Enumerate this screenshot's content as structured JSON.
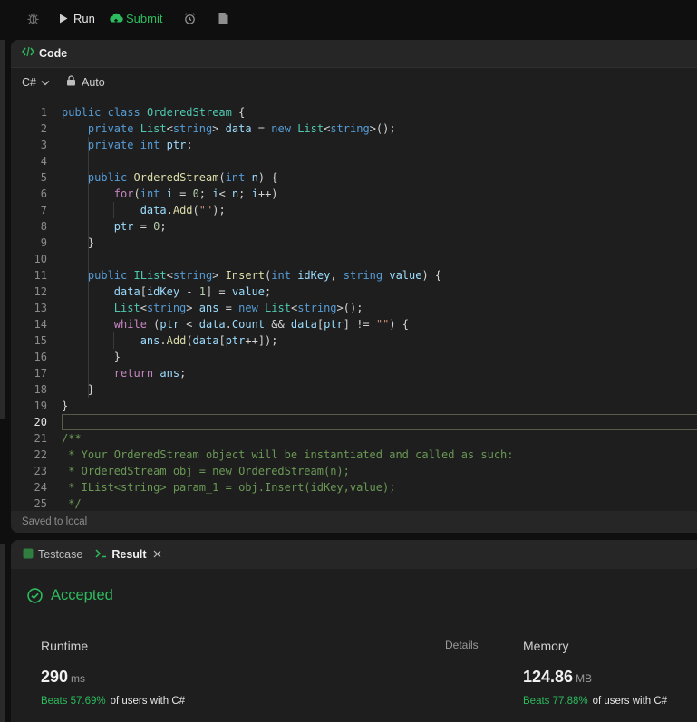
{
  "toolbar": {
    "run_label": "Run",
    "submit_label": "Submit"
  },
  "code_panel": {
    "title": "Code",
    "language": "C#",
    "mode": "Auto",
    "status": "Saved to local"
  },
  "editor": {
    "active_line": 20,
    "lines": [
      {
        "n": "1",
        "tokens": [
          [
            "kw",
            "public"
          ],
          [
            "p",
            " "
          ],
          [
            "kw",
            "class"
          ],
          [
            "p",
            " "
          ],
          [
            "ty",
            "OrderedStream"
          ],
          [
            "p",
            " {"
          ]
        ]
      },
      {
        "n": "2",
        "tokens": [
          [
            "p",
            "    "
          ],
          [
            "kw",
            "private"
          ],
          [
            "p",
            " "
          ],
          [
            "ty",
            "List"
          ],
          [
            "p",
            "<"
          ],
          [
            "kw",
            "string"
          ],
          [
            "p",
            "> "
          ],
          [
            "nm",
            "data"
          ],
          [
            "p",
            " = "
          ],
          [
            "kw",
            "new"
          ],
          [
            "p",
            " "
          ],
          [
            "ty",
            "List"
          ],
          [
            "p",
            "<"
          ],
          [
            "kw",
            "string"
          ],
          [
            "p",
            ">();"
          ]
        ]
      },
      {
        "n": "3",
        "tokens": [
          [
            "p",
            "    "
          ],
          [
            "kw",
            "private"
          ],
          [
            "p",
            " "
          ],
          [
            "kw",
            "int"
          ],
          [
            "p",
            " "
          ],
          [
            "nm",
            "ptr"
          ],
          [
            "p",
            ";"
          ]
        ]
      },
      {
        "n": "4",
        "tokens": []
      },
      {
        "n": "5",
        "tokens": [
          [
            "p",
            "    "
          ],
          [
            "kw",
            "public"
          ],
          [
            "p",
            " "
          ],
          [
            "fn",
            "OrderedStream"
          ],
          [
            "p",
            "("
          ],
          [
            "kw",
            "int"
          ],
          [
            "p",
            " "
          ],
          [
            "nm",
            "n"
          ],
          [
            "p",
            ") {"
          ]
        ]
      },
      {
        "n": "6",
        "tokens": [
          [
            "p",
            "        "
          ],
          [
            "ct",
            "for"
          ],
          [
            "p",
            "("
          ],
          [
            "kw",
            "int"
          ],
          [
            "p",
            " "
          ],
          [
            "nm",
            "i"
          ],
          [
            "p",
            " = "
          ],
          [
            "nu",
            "0"
          ],
          [
            "p",
            "; "
          ],
          [
            "nm",
            "i"
          ],
          [
            "p",
            "< "
          ],
          [
            "nm",
            "n"
          ],
          [
            "p",
            "; "
          ],
          [
            "nm",
            "i"
          ],
          [
            "p",
            "++)"
          ]
        ]
      },
      {
        "n": "7",
        "tokens": [
          [
            "p",
            "            "
          ],
          [
            "nm",
            "data"
          ],
          [
            "p",
            "."
          ],
          [
            "fn",
            "Add"
          ],
          [
            "p",
            "("
          ],
          [
            "st",
            "\"\""
          ],
          [
            "p",
            ");"
          ]
        ]
      },
      {
        "n": "8",
        "tokens": [
          [
            "p",
            "        "
          ],
          [
            "nm",
            "ptr"
          ],
          [
            "p",
            " = "
          ],
          [
            "nu",
            "0"
          ],
          [
            "p",
            ";"
          ]
        ]
      },
      {
        "n": "9",
        "tokens": [
          [
            "p",
            "    }"
          ]
        ]
      },
      {
        "n": "10",
        "tokens": []
      },
      {
        "n": "11",
        "tokens": [
          [
            "p",
            "    "
          ],
          [
            "kw",
            "public"
          ],
          [
            "p",
            " "
          ],
          [
            "ty",
            "IList"
          ],
          [
            "p",
            "<"
          ],
          [
            "kw",
            "string"
          ],
          [
            "p",
            "> "
          ],
          [
            "fn",
            "Insert"
          ],
          [
            "p",
            "("
          ],
          [
            "kw",
            "int"
          ],
          [
            "p",
            " "
          ],
          [
            "nm",
            "idKey"
          ],
          [
            "p",
            ", "
          ],
          [
            "kw",
            "string"
          ],
          [
            "p",
            " "
          ],
          [
            "nm",
            "value"
          ],
          [
            "p",
            ") {"
          ]
        ]
      },
      {
        "n": "12",
        "tokens": [
          [
            "p",
            "        "
          ],
          [
            "nm",
            "data"
          ],
          [
            "p",
            "["
          ],
          [
            "nm",
            "idKey"
          ],
          [
            "p",
            " - "
          ],
          [
            "nu",
            "1"
          ],
          [
            "p",
            "] = "
          ],
          [
            "nm",
            "value"
          ],
          [
            "p",
            ";"
          ]
        ]
      },
      {
        "n": "13",
        "tokens": [
          [
            "p",
            "        "
          ],
          [
            "ty",
            "List"
          ],
          [
            "p",
            "<"
          ],
          [
            "kw",
            "string"
          ],
          [
            "p",
            "> "
          ],
          [
            "nm",
            "ans"
          ],
          [
            "p",
            " = "
          ],
          [
            "kw",
            "new"
          ],
          [
            "p",
            " "
          ],
          [
            "ty",
            "List"
          ],
          [
            "p",
            "<"
          ],
          [
            "kw",
            "string"
          ],
          [
            "p",
            ">();"
          ]
        ]
      },
      {
        "n": "14",
        "tokens": [
          [
            "p",
            "        "
          ],
          [
            "ct",
            "while"
          ],
          [
            "p",
            " ("
          ],
          [
            "nm",
            "ptr"
          ],
          [
            "p",
            " < "
          ],
          [
            "nm",
            "data"
          ],
          [
            "p",
            "."
          ],
          [
            "nm",
            "Count"
          ],
          [
            "p",
            " && "
          ],
          [
            "nm",
            "data"
          ],
          [
            "p",
            "["
          ],
          [
            "nm",
            "ptr"
          ],
          [
            "p",
            "] != "
          ],
          [
            "st",
            "\"\""
          ],
          [
            "p",
            ") {"
          ]
        ]
      },
      {
        "n": "15",
        "tokens": [
          [
            "p",
            "            "
          ],
          [
            "nm",
            "ans"
          ],
          [
            "p",
            "."
          ],
          [
            "fn",
            "Add"
          ],
          [
            "p",
            "("
          ],
          [
            "nm",
            "data"
          ],
          [
            "p",
            "["
          ],
          [
            "nm",
            "ptr"
          ],
          [
            "p",
            "++]);"
          ]
        ]
      },
      {
        "n": "16",
        "tokens": [
          [
            "p",
            "        }"
          ]
        ]
      },
      {
        "n": "17",
        "tokens": [
          [
            "p",
            "        "
          ],
          [
            "ct",
            "return"
          ],
          [
            "p",
            " "
          ],
          [
            "nm",
            "ans"
          ],
          [
            "p",
            ";"
          ]
        ]
      },
      {
        "n": "18",
        "tokens": [
          [
            "p",
            "    }"
          ]
        ]
      },
      {
        "n": "19",
        "tokens": [
          [
            "p",
            "}"
          ]
        ]
      },
      {
        "n": "20",
        "tokens": []
      },
      {
        "n": "21",
        "tokens": [
          [
            "cm",
            "/**"
          ]
        ]
      },
      {
        "n": "22",
        "tokens": [
          [
            "cm",
            " * Your OrderedStream object will be instantiated and called as such:"
          ]
        ]
      },
      {
        "n": "23",
        "tokens": [
          [
            "cm",
            " * OrderedStream obj = new OrderedStream(n);"
          ]
        ]
      },
      {
        "n": "24",
        "tokens": [
          [
            "cm",
            " * IList<string> param_1 = obj.Insert(idKey,value);"
          ]
        ]
      },
      {
        "n": "25",
        "tokens": [
          [
            "cm",
            " */"
          ]
        ]
      }
    ]
  },
  "result_panel": {
    "tab_testcase": "Testcase",
    "tab_result": "Result",
    "verdict": "Accepted",
    "details_label": "Details",
    "runtime": {
      "label": "Runtime",
      "value": "290",
      "unit": "ms",
      "beats_pct": "Beats 57.69%",
      "beats_suffix": "of users with C#"
    },
    "memory": {
      "label": "Memory",
      "value": "124.86",
      "unit": "MB",
      "beats_pct": "Beats 77.88%",
      "beats_suffix": "of users with C#"
    }
  },
  "colors": {
    "accent_green": "#2cbb5d",
    "panel_bg": "#1e1e1e",
    "header_bg": "#262626",
    "page_bg": "#0f0f0f"
  }
}
